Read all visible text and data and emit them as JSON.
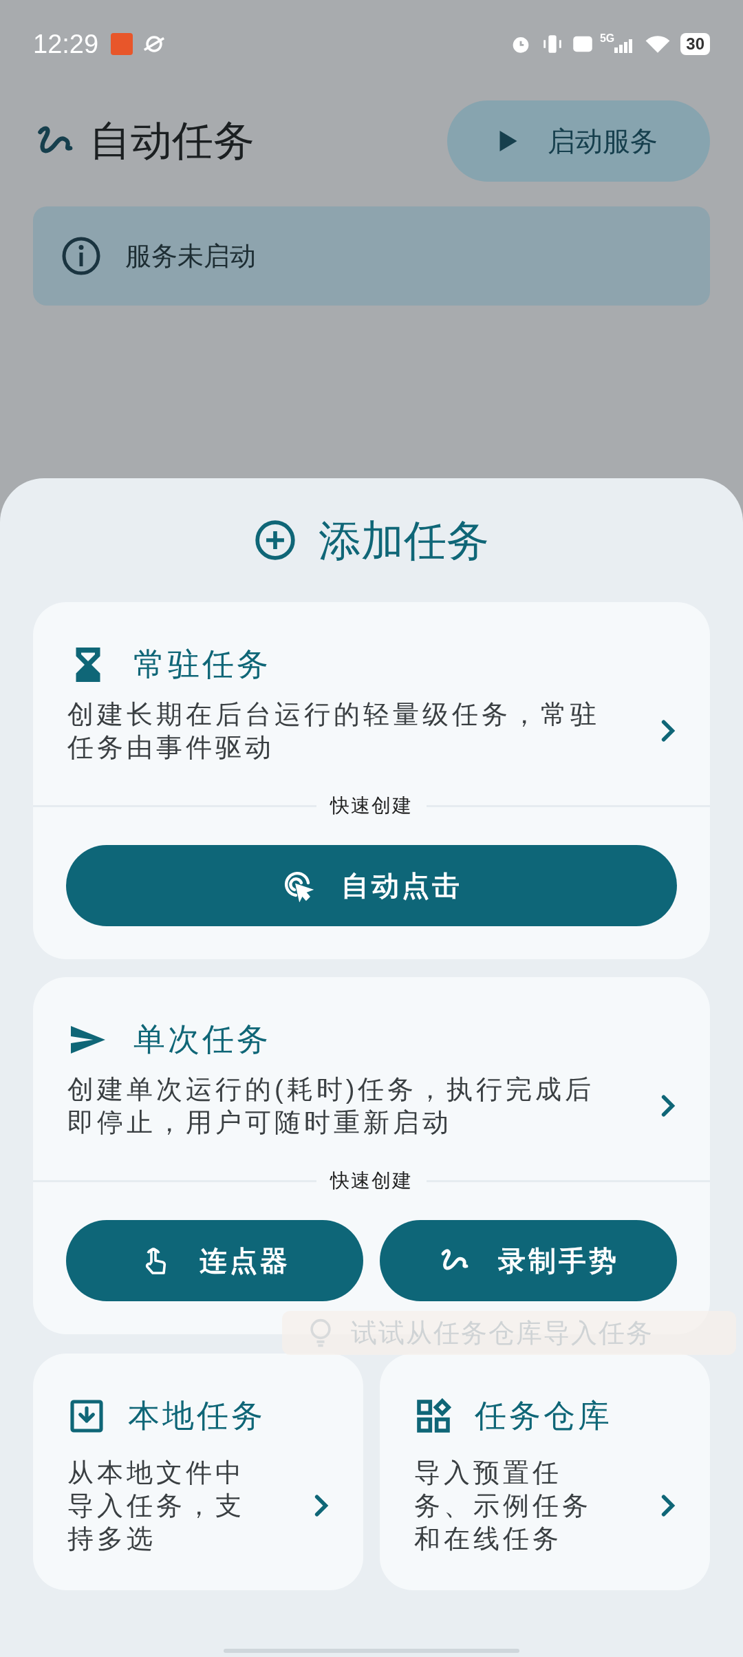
{
  "status_bar": {
    "time": "12:29",
    "network": "5G",
    "battery": "30"
  },
  "header": {
    "title": "自动任务",
    "start_button": "启动服务"
  },
  "banner": {
    "text": "服务未启动"
  },
  "sheet": {
    "title": "添加任务",
    "wide_cards": [
      {
        "title": "常驻任务",
        "description": "创建长期在后台运行的轻量级任务，常驻任务由事件驱动",
        "quick_create_label": "快速创建",
        "quick_actions": [
          {
            "label": "自动点击"
          }
        ]
      },
      {
        "title": "单次任务",
        "description": "创建单次运行的(耗时)任务，执行完成后即停止，用户可随时重新启动",
        "quick_create_label": "快速创建",
        "quick_actions": [
          {
            "label": "连点器"
          },
          {
            "label": "录制手势"
          }
        ]
      }
    ],
    "small_cards": [
      {
        "title": "本地任务",
        "description": "从本地文件中导入任务，支持多选"
      },
      {
        "title": "任务仓库",
        "description": "导入预置任务、示例任务和在线任务"
      }
    ]
  },
  "toast": {
    "text": "试试从任务仓库导入任务"
  }
}
